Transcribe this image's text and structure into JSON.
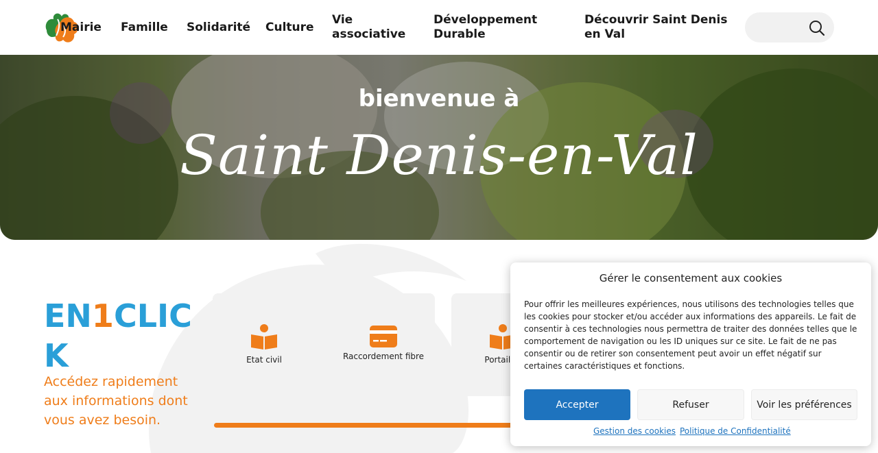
{
  "header": {
    "logo_alt": "Saint Denis en Val",
    "nav": [
      {
        "label": "Mairie"
      },
      {
        "label": "Famille"
      },
      {
        "label": "Solidarité"
      },
      {
        "label": "Culture"
      },
      {
        "label": "Vie associative"
      },
      {
        "label": "Développement Durable"
      },
      {
        "label": "Découvrir Saint Denis en Val"
      }
    ],
    "search_placeholder": ""
  },
  "hero": {
    "subtitle": "bienvenue à",
    "title": "Saint Denis-en-Val"
  },
  "quick_access": {
    "heading_part1": "EN",
    "heading_number": "1",
    "heading_part2": "CLICK",
    "description": "Accédez rapidement aux informations dont vous avez besoin.",
    "cards": [
      {
        "label": "Etat civil",
        "icon": "book-reader-icon"
      },
      {
        "label": "Raccordement fibre",
        "icon": "credit-card-icon"
      },
      {
        "label": "Portail fa",
        "icon": "book-reader-icon"
      }
    ]
  },
  "cookie_banner": {
    "title": "Gérer le consentement aux cookies",
    "text": "Pour offrir les meilleures expériences, nous utilisons des technologies telles que les cookies pour stocker et/ou accéder aux informations des appareils. Le fait de consentir à ces technologies nous permettra de traiter des données telles que le comportement de navigation ou les ID uniques sur ce site. Le fait de ne pas consentir ou de retirer son consentement peut avoir un effet négatif sur certaines caractéristiques et fonctions.",
    "accept_label": "Accepter",
    "refuse_label": "Refuser",
    "prefs_label": "Voir les préférences",
    "link_cookies": "Gestion des cookies",
    "link_privacy": "Politique de Confidentialité"
  },
  "colors": {
    "accent_blue": "#2a9fd8",
    "accent_orange": "#ef7d1a",
    "button_blue": "#1e73be",
    "logo_green": "#2e8b3a"
  }
}
